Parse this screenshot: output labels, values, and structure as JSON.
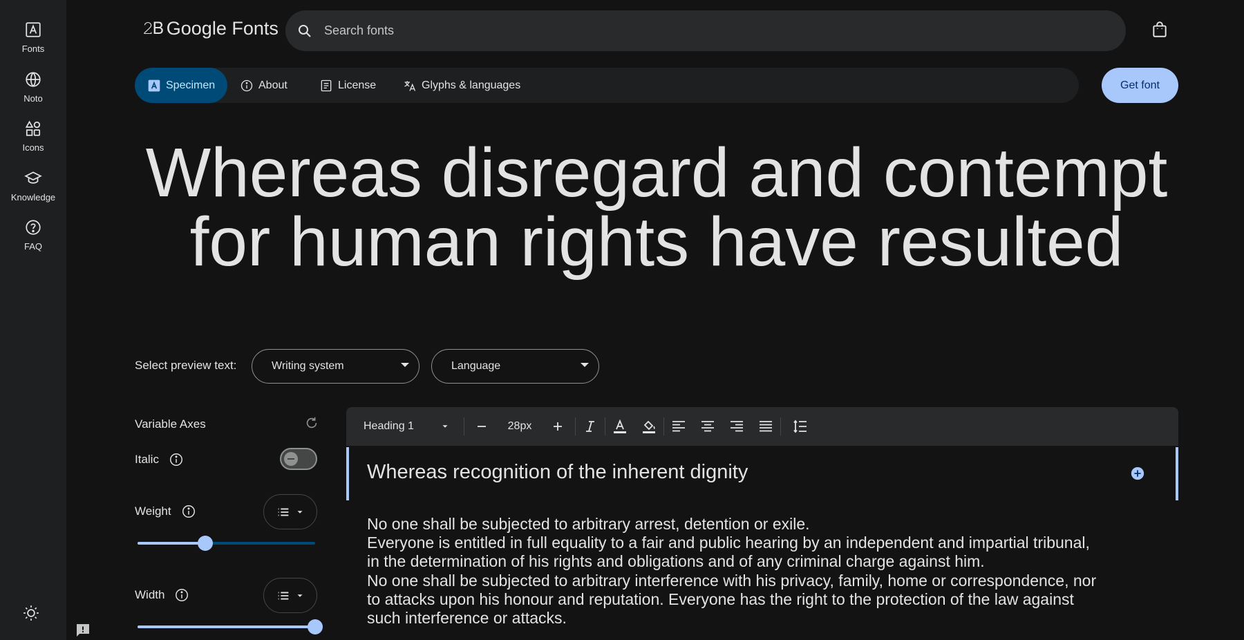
{
  "rail": {
    "items": [
      {
        "label": "Fonts",
        "icon": "font-icon"
      },
      {
        "label": "Noto",
        "icon": "globe-icon"
      },
      {
        "label": "Icons",
        "icon": "shapes-icon"
      },
      {
        "label": "Knowledge",
        "icon": "school-icon"
      },
      {
        "label": "FAQ",
        "icon": "help-icon"
      }
    ]
  },
  "header": {
    "logo_text": "Google Fonts",
    "logo_mark": "𝟸𝖡",
    "search_placeholder": "Search fonts"
  },
  "tabs": [
    {
      "label": "Specimen",
      "active": true
    },
    {
      "label": "About",
      "active": false
    },
    {
      "label": "License",
      "active": false
    },
    {
      "label": "Glyphs & languages",
      "active": false
    }
  ],
  "get_font_label": "Get font",
  "hero": {
    "line1": "Whereas disregard and contempt",
    "line2": "for human rights have resulted"
  },
  "preview": {
    "label": "Select preview text:",
    "writing_system": "Writing system",
    "language": "Language"
  },
  "axes": {
    "title": "Variable Axes",
    "italic_label": "Italic",
    "italic_on": false,
    "weight_label": "Weight",
    "weight_fraction": 0.38,
    "width_label": "Width",
    "width_fraction": 1.0
  },
  "editor": {
    "style_select": "Heading 1",
    "font_size": "28px",
    "heading": "Whereas recognition of the inherent dignity",
    "body_lines": [
      "No one shall be subjected to arbitrary arrest, detention or exile.",
      "Everyone is entitled in full equality to a fair and public hearing by an independent and impartial tribunal,",
      "in the determination of his rights and obligations and of any criminal charge against him.",
      "No one shall be subjected to arbitrary interference with his privacy, family, home or correspondence, nor",
      "to attacks upon his honour and reputation. Everyone has the right to the protection of the law against",
      "such interference or attacks."
    ]
  },
  "colors": {
    "background": "#131314",
    "rail": "#1e1f20",
    "accent": "#a8c7fa",
    "active_tab": "#004a77"
  }
}
